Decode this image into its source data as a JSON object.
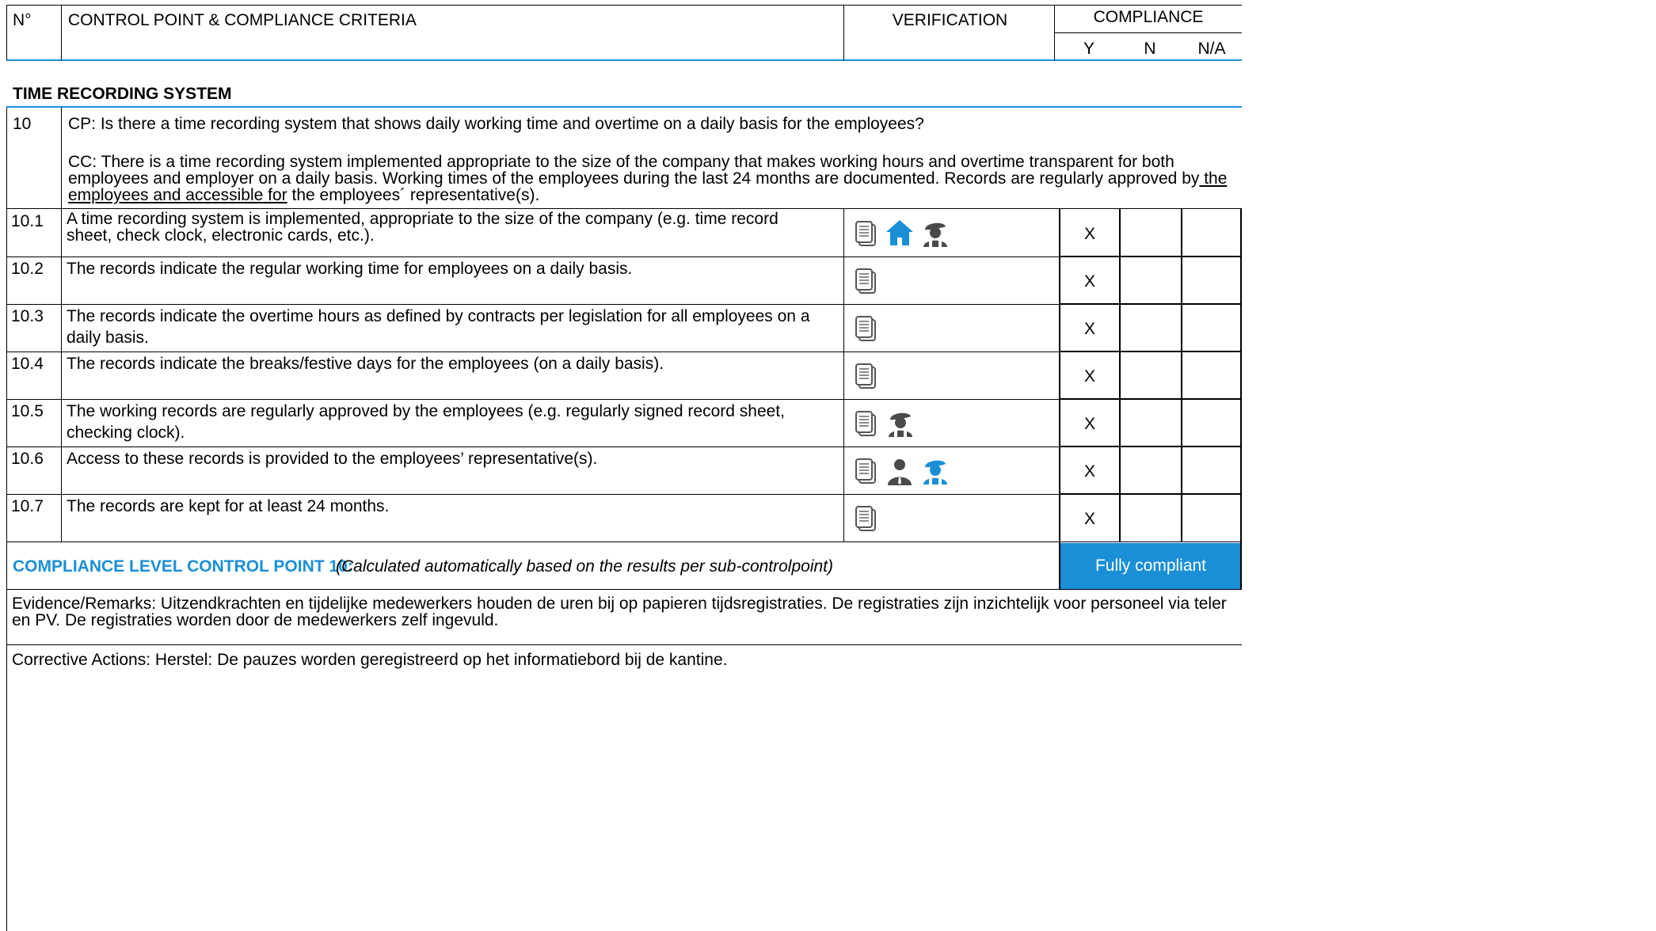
{
  "header": {
    "no": "N°",
    "criteria": "CONTROL POINT & COMPLIANCE CRITERIA",
    "verification": "VERIFICATION",
    "compliance": "COMPLIANCE",
    "y": "Y",
    "n": "N",
    "na": "N/A"
  },
  "section": {
    "title": "TIME RECORDING SYSTEM"
  },
  "control_point": {
    "number": "10",
    "cp": "CP: Is there a time recording system that shows daily working time and overtime on a daily basis for the employees?",
    "cc_part1": "CC: There is a time recording system implemented appropriate to the size of the company that makes working hours and overtime transparent for both employees and employer on a daily basis. Working times of the employees during the last 24 months are documented. Records are regularly approved by",
    "cc_underlined": " the employees and accessible for",
    "cc_part2": " the employees´ representative(s)."
  },
  "rows": [
    {
      "number": "10.1",
      "text": "A time recording system is implemented, appropriate to the size of the company (e.g. time record sheet, check clock, electronic cards, etc.).",
      "icons": [
        "document-icon",
        "home-icon",
        "worker-icon"
      ],
      "y": "X"
    },
    {
      "number": "10.2",
      "text": "The records indicate the regular working time for employees on a daily basis.",
      "icons": [
        "document-icon"
      ],
      "y": "X"
    },
    {
      "number": "10.3",
      "text": "The records indicate the overtime hours as defined by contracts per legislation for all employees on a daily basis.",
      "icons": [
        "document-icon"
      ],
      "y": "X"
    },
    {
      "number": "10.4",
      "text": "The records indicate the breaks/festive days for the employees (on a daily basis).",
      "icons": [
        "document-icon"
      ],
      "y": "X"
    },
    {
      "number": "10.5",
      "text": "The working records are regularly approved by the employees (e.g. regularly signed record sheet, checking clock).",
      "icons": [
        "document-icon",
        "worker-icon"
      ],
      "y": "X"
    },
    {
      "number": "10.6",
      "text": "Access to these records is provided to the employees’ representative(s).",
      "icons": [
        "document-icon",
        "manager-icon",
        "worker-icon"
      ],
      "y": "X"
    },
    {
      "number": "10.7",
      "text": "The records are kept for at least 24 months.",
      "icons": [
        "document-icon"
      ],
      "y": "X"
    }
  ],
  "compliance_level": {
    "label": "COMPLIANCE LEVEL CONTROL POINT 10:",
    "note": "(Calculated automatically based on the results per sub-controlpoint)",
    "result": "Fully compliant"
  },
  "evidence": "Evidence/Remarks: Uitzendkrachten en tijdelijke medewerkers houden de uren bij op papieren tijdsregistraties. De registraties zijn inzichtelijk voor personeel via teler en PV. De registraties worden door de medewerkers zelf ingevuld.",
  "corrective": "Corrective Actions: Herstel: De pauzes worden geregistreerd op het informatiebord bij de kantine.",
  "colors": {
    "accent": "#1a8fd6",
    "icon_gray": "#4a4a4a",
    "border": "#000000"
  }
}
